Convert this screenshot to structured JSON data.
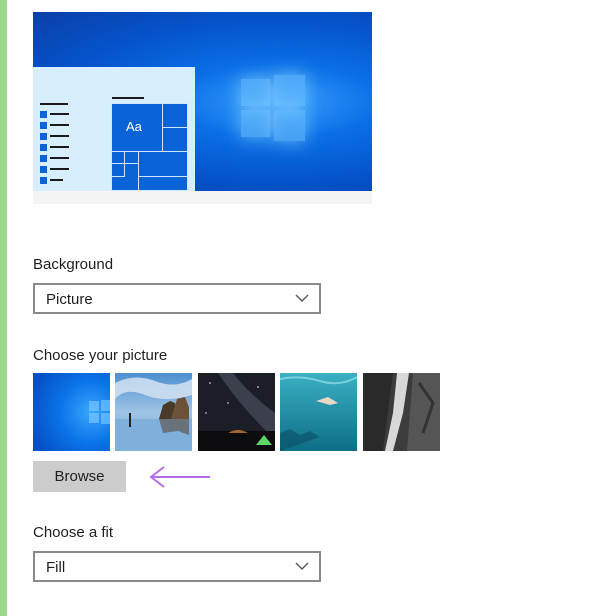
{
  "preview": {
    "tile_text": "Aa"
  },
  "background": {
    "label": "Background",
    "selected": "Picture"
  },
  "choose_picture": {
    "label": "Choose your picture",
    "thumbnails": [
      {
        "name": "windows-default"
      },
      {
        "name": "beach-rocks"
      },
      {
        "name": "night-sky-tent"
      },
      {
        "name": "underwater-swimmer"
      },
      {
        "name": "rock-waterfall"
      }
    ]
  },
  "browse": {
    "label": "Browse"
  },
  "fit": {
    "label": "Choose a fit",
    "selected": "Fill"
  },
  "colors": {
    "accent_blue": "#0a64d8",
    "annotation_arrow": "#b36ee8",
    "left_accent": "#9ed98a"
  }
}
